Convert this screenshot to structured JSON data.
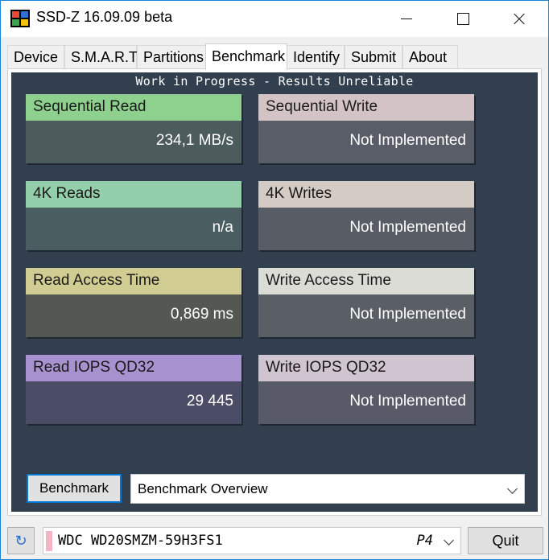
{
  "window": {
    "title": "SSD-Z 16.09.09 beta"
  },
  "tabs": [
    {
      "label": "Device",
      "active": false
    },
    {
      "label": "S.M.A.R.T.",
      "active": false
    },
    {
      "label": "Partitions",
      "active": false
    },
    {
      "label": "Benchmark",
      "active": true
    },
    {
      "label": "Identify",
      "active": false
    },
    {
      "label": "Submit",
      "active": false
    },
    {
      "label": "About",
      "active": false
    }
  ],
  "benchmark": {
    "warning": "Work in Progress - Results Unreliable",
    "cards": [
      {
        "label": "Sequential Read",
        "value": "234,1 MB/s",
        "color": "#8ed08e"
      },
      {
        "label": "Sequential Write",
        "value": "Not Implemented",
        "color": "#d3c3c5"
      },
      {
        "label": "4K Reads",
        "value": "n/a",
        "color": "#93cfab"
      },
      {
        "label": "4K Writes",
        "value": "Not Implemented",
        "color": "#d5cbc5"
      },
      {
        "label": "Read Access Time",
        "value": "0,869 ms",
        "color": "#d1cd92"
      },
      {
        "label": "Write Access Time",
        "value": "Not Implemented",
        "color": "#dcdcd6"
      },
      {
        "label": "Read IOPS QD32",
        "value": "29 445",
        "color": "#a792cf"
      },
      {
        "label": "Write IOPS QD32",
        "value": "Not Implemented",
        "color": "#cfc4cf"
      }
    ],
    "run_button": "Benchmark",
    "mode_select": "Benchmark Overview"
  },
  "footer": {
    "refresh_icon": "refresh-icon",
    "drive_name": "WDC WD20SMZM-59H3FS1",
    "drive_port": "P4",
    "quit_button": "Quit"
  }
}
